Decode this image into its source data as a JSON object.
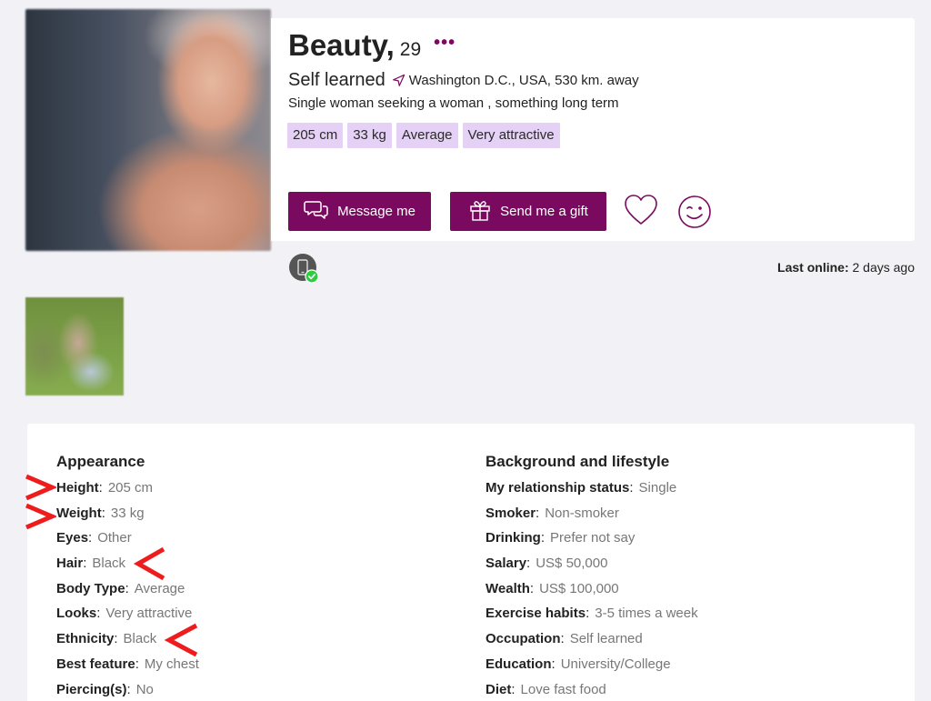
{
  "profile": {
    "name": "Beauty,",
    "age": "29",
    "more_label": "•••",
    "occupation": "Self learned",
    "location": "Washington D.C., USA, 530 km. away",
    "seeking": "Single woman seeking a woman , something long term",
    "tags": [
      "205 cm",
      "33 kg",
      "Average",
      "Very attractive"
    ]
  },
  "actions": {
    "message_label": "Message me",
    "gift_label": "Send me a gift"
  },
  "status": {
    "last_online_label": "Last online:",
    "last_online_value": "2 days ago"
  },
  "appearance": {
    "title": "Appearance",
    "rows": [
      {
        "label": "Height",
        "value": "205 cm"
      },
      {
        "label": "Weight",
        "value": "33 kg"
      },
      {
        "label": "Eyes",
        "value": "Other"
      },
      {
        "label": "Hair",
        "value": "Black"
      },
      {
        "label": "Body Type",
        "value": "Average"
      },
      {
        "label": "Looks",
        "value": "Very attractive"
      },
      {
        "label": "Ethnicity",
        "value": "Black"
      },
      {
        "label": "Best feature",
        "value": "My chest"
      },
      {
        "label": "Piercing(s)",
        "value": "No"
      }
    ]
  },
  "background": {
    "title": "Background and lifestyle",
    "rows": [
      {
        "label": "My relationship status",
        "value": "Single"
      },
      {
        "label": "Smoker",
        "value": "Non-smoker"
      },
      {
        "label": "Drinking",
        "value": "Prefer not say"
      },
      {
        "label": "Salary",
        "value": "US$ 50,000"
      },
      {
        "label": "Wealth",
        "value": "US$ 100,000"
      },
      {
        "label": "Exercise habits",
        "value": "3-5 times a week"
      },
      {
        "label": "Occupation",
        "value": "Self learned"
      },
      {
        "label": "Education",
        "value": "University/College"
      },
      {
        "label": "Diet",
        "value": "Love fast food"
      }
    ]
  },
  "colors": {
    "brand": "#7a0a5f",
    "tag_bg": "#e5d1f5",
    "annotation_red": "#ee1c1c",
    "online_green": "#2ecc40"
  }
}
